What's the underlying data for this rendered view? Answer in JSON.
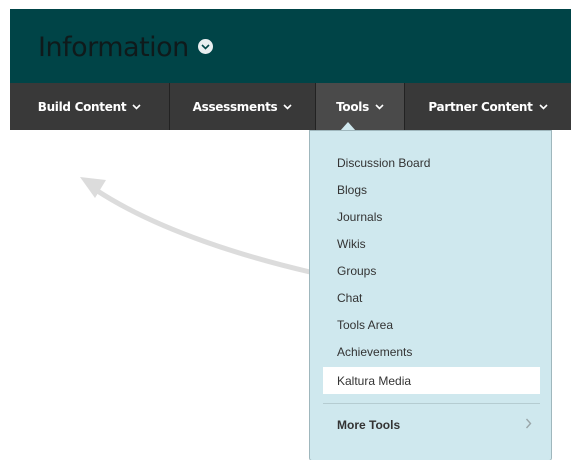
{
  "header": {
    "title": "Information",
    "title_color": "#004447"
  },
  "nav": {
    "tabs": [
      {
        "label": "Build Content",
        "active": false
      },
      {
        "label": "Assessments",
        "active": false
      },
      {
        "label": "Tools",
        "active": true
      },
      {
        "label": "Partner Content",
        "active": false
      }
    ]
  },
  "tools_menu": {
    "items": [
      {
        "label": "Discussion Board"
      },
      {
        "label": "Blogs"
      },
      {
        "label": "Journals"
      },
      {
        "label": "Wikis"
      },
      {
        "label": "Groups"
      },
      {
        "label": "Chat"
      },
      {
        "label": "Tools Area"
      },
      {
        "label": "Achievements"
      },
      {
        "label": "Kaltura Media",
        "selected": true
      }
    ],
    "more_tools_label": "More Tools",
    "background": "#cfe8ee"
  },
  "icons": {
    "title_menu": "chevron-down-circle-icon",
    "tab_chevron": "chevron-down-icon",
    "more_tools_arrow": "chevron-right-icon"
  }
}
